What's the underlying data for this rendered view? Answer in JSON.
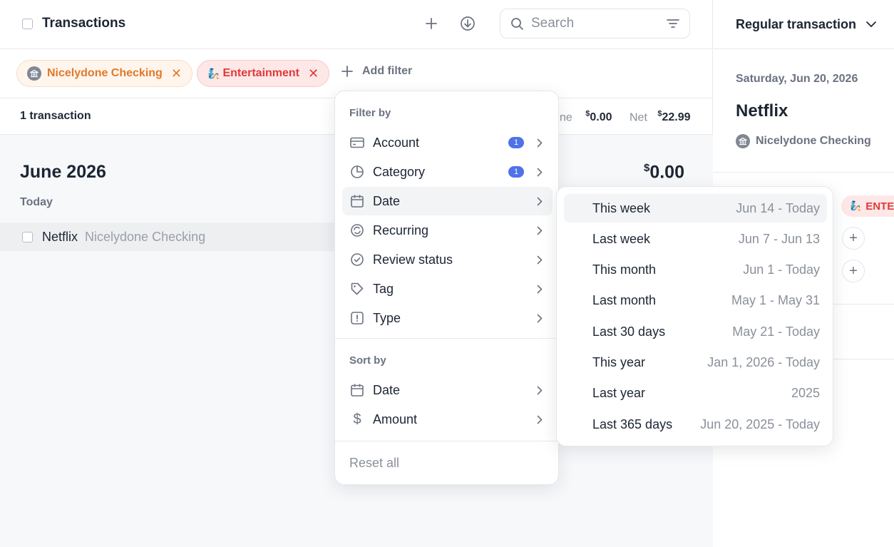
{
  "header": {
    "title": "Transactions",
    "add_icon": "plus-icon",
    "download_icon": "download-circle-icon"
  },
  "search": {
    "placeholder": "Search"
  },
  "filters": {
    "chips": [
      {
        "label": "Nicelydone Checking",
        "color": "#e07a2b"
      },
      {
        "label": "Entertainment",
        "color": "#e03a3a"
      }
    ],
    "add_label": "Add filter"
  },
  "summary": {
    "count": "1 transaction",
    "income_label_fragment": "ne",
    "income_symbol": "$",
    "income_value": "0.00",
    "net_label": "Net",
    "net_symbol": "$",
    "net_value": "22.99"
  },
  "list": {
    "month": "June 2026",
    "month_total_symbol": "$",
    "month_total_value": "0.00",
    "group_label": "Today",
    "rows": [
      {
        "name": "Netflix",
        "account": "Nicelydone Checking"
      }
    ]
  },
  "detail": {
    "type_label": "Regular transaction",
    "date": "Saturday, Jun 20, 2026",
    "merchant": "Netflix",
    "account": "Nicelydone Checking",
    "category_fragment": "ENTE"
  },
  "filter_menu": {
    "filter_by_label": "Filter by",
    "filter_items": [
      {
        "label": "Account",
        "icon": "credit-card-icon",
        "badge": "1"
      },
      {
        "label": "Category",
        "icon": "pie-chart-icon",
        "badge": "1"
      },
      {
        "label": "Date",
        "icon": "calendar-icon",
        "badge": ""
      },
      {
        "label": "Recurring",
        "icon": "recurring-icon",
        "badge": ""
      },
      {
        "label": "Review status",
        "icon": "check-circle-icon",
        "badge": ""
      },
      {
        "label": "Tag",
        "icon": "tag-icon",
        "badge": ""
      },
      {
        "label": "Type",
        "icon": "type-icon",
        "badge": ""
      }
    ],
    "sort_by_label": "Sort by",
    "sort_items": [
      {
        "label": "Date",
        "icon": "calendar-icon"
      },
      {
        "label": "Amount",
        "icon": "dollar-icon"
      }
    ],
    "reset_label": "Reset all"
  },
  "date_submenu": {
    "items": [
      {
        "label": "This week",
        "range": "Jun 14 - Today"
      },
      {
        "label": "Last week",
        "range": "Jun 7 - Jun 13"
      },
      {
        "label": "This month",
        "range": "Jun 1 - Today"
      },
      {
        "label": "Last month",
        "range": "May 1 - May 31"
      },
      {
        "label": "Last 30 days",
        "range": "May 21 - Today"
      },
      {
        "label": "This year",
        "range": "Jan 1, 2026 - Today"
      },
      {
        "label": "Last year",
        "range": "2025"
      },
      {
        "label": "Last 365 days",
        "range": "Jun 20, 2025 - Today"
      }
    ]
  },
  "colors": {
    "accent_blue": "#4f72e8",
    "orange_chip": "#e07a2b",
    "red_chip": "#e03a3a"
  }
}
